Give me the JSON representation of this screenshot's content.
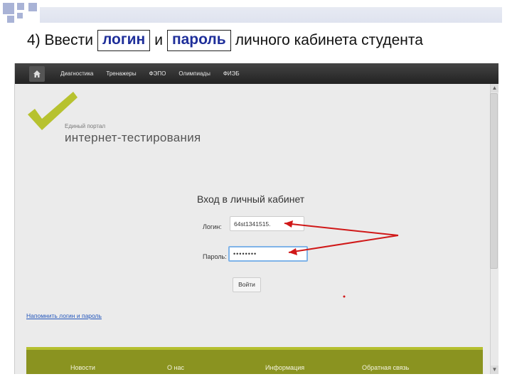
{
  "slide": {
    "title_prefix": "4) Ввести",
    "word_login": "логин",
    "word_and": "и",
    "word_password": "пароль",
    "title_suffix": "личного кабинета студента"
  },
  "nav": {
    "home_icon": "home-icon",
    "items": [
      "Диагностика",
      "Тренажеры",
      "ФЭПО",
      "Олимпиады",
      "ФИЭБ"
    ]
  },
  "logo": {
    "small": "Единый портал",
    "big": "интернет-тестирования",
    "color": "#b7c22f"
  },
  "login": {
    "heading": "Вход в личный кабинет",
    "login_label": "Логин:",
    "login_value": "64st1341515.",
    "password_label": "Пароль:",
    "password_value": "••••••••",
    "submit": "Войти",
    "recover_link": "Напомнить логин и пароль"
  },
  "footer": {
    "items": [
      "Новости",
      "О нас",
      "Информация",
      "Обратная связь"
    ],
    "color": "#8a9320"
  },
  "annotation": {
    "arrow_color": "#d01818"
  }
}
